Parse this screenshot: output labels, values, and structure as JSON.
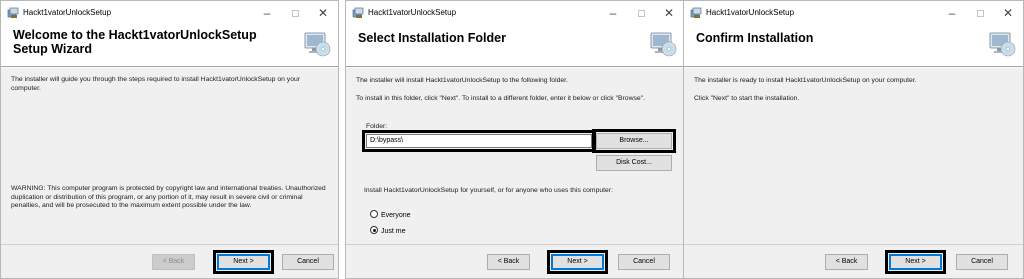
{
  "app_title": "Hackt1vatorUnlockSetup",
  "titlebar": {
    "minimize": "–",
    "close": "✕"
  },
  "buttons": {
    "back": "< Back",
    "next": "Next >",
    "cancel": "Cancel",
    "browse": "Browse...",
    "disk_cost": "Disk Cost..."
  },
  "window1": {
    "heading": "Welcome to the Hackt1vatorUnlockSetup Setup Wizard",
    "intro": "The installer will guide you through the steps required to install Hackt1vatorUnlockSetup on your computer.",
    "warning": "WARNING: This computer program is protected by copyright law and international treaties. Unauthorized duplication or distribution of this program, or any portion of it, may result in severe civil or criminal penalties, and will be prosecuted to the maximum extent possible under the law."
  },
  "window2": {
    "heading": "Select Installation Folder",
    "line1": "The installer will install Hackt1vatorUnlockSetup to the following folder.",
    "line2": "To install in this folder, click \"Next\". To install to a different folder, enter it below or click \"Browse\".",
    "folder_label": "Folder:",
    "folder_value": "D:\\bypass\\",
    "install_for": "Install Hackt1vatorUnlockSetup for yourself, or for anyone who uses this computer:",
    "options": {
      "everyone": "Everyone",
      "just_me": "Just me"
    },
    "selected_option": "just_me"
  },
  "window3": {
    "heading": "Confirm Installation",
    "line1": "The installer is ready to install Hackt1vatorUnlockSetup on your computer.",
    "line2": "Click \"Next\" to start the installation."
  },
  "icons": {
    "app": "installer-app-icon",
    "banner": "computer-cd-icon"
  },
  "colors": {
    "highlight": "#000000",
    "default_button_border": "#0078d7",
    "panel_bg": "#f0f0f0"
  }
}
